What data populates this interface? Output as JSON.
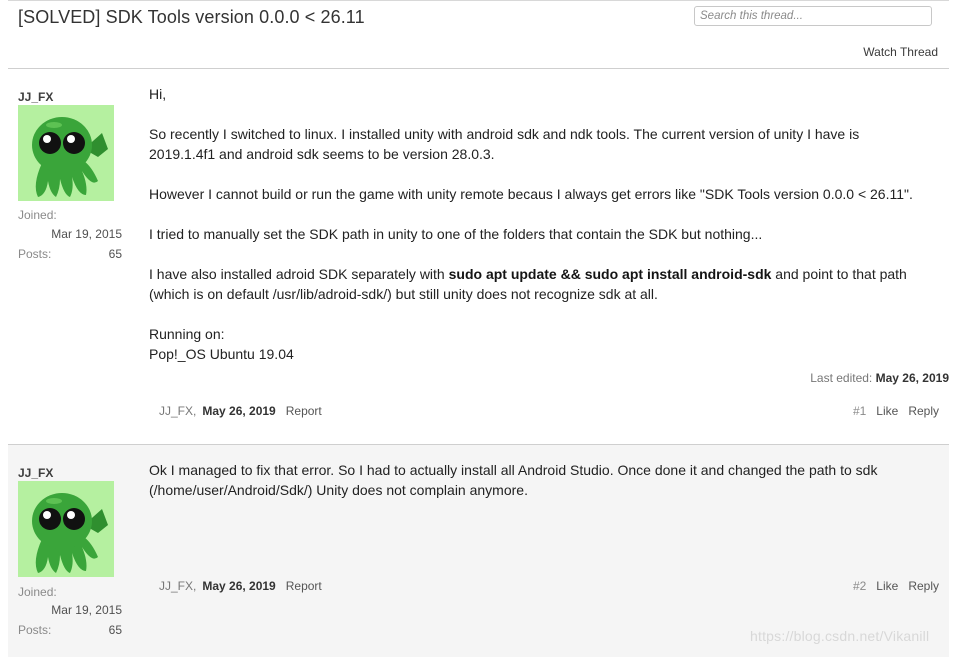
{
  "thread": {
    "title": "[SOLVED] SDK Tools version 0.0.0 < 26.11",
    "search_placeholder": "Search this thread...",
    "watch_label": "Watch Thread"
  },
  "posts": [
    {
      "author": "JJ_FX",
      "joined_label": "Joined:",
      "joined_value": "Mar 19, 2015",
      "posts_label": "Posts:",
      "posts_value": "65",
      "paragraphs": {
        "p1": "Hi,",
        "p2a": "So recently I switched to linux. I installed unity with android sdk and ndk tools. The current version of unity I have is",
        "p2b": "2019.1.4f1 and android sdk seems to be version 28.0.3.",
        "p3": "However I cannot build or run the game with unity remote becaus I always get errors like \"SDK Tools version 0.0.0 < 26.11\".",
        "p4": "I tried to manually set the SDK path in unity to one of the folders that contain the SDK but nothing...",
        "p5_pre": "I have also installed adroid SDK separately with ",
        "p5_bold": "sudo apt update && sudo apt install android-sdk",
        "p5_post": " and point to that path",
        "p5_line2": "(which is on default /usr/lib/adroid-sdk/) but still unity does not recognize sdk at all.",
        "p6a": "Running on:",
        "p6b": "Pop!_OS Ubuntu 19.04"
      },
      "edited_label": "Last edited:",
      "edited_date": "May 26, 2019",
      "footer_author": "JJ_FX,",
      "footer_date": "May 26, 2019",
      "report": "Report",
      "number": "#1",
      "like": "Like",
      "reply": "Reply"
    },
    {
      "author": "JJ_FX",
      "joined_label": "Joined:",
      "joined_value": "Mar 19, 2015",
      "posts_label": "Posts:",
      "posts_value": "65",
      "paragraphs": {
        "l1": "Ok I managed to fix that error. So I had to actually install all Android Studio. Once done it and changed the path to sdk",
        "l2": "(/home/user/Android/Sdk/) Unity does not complain anymore."
      },
      "footer_author": "JJ_FX,",
      "footer_date": "May 26, 2019",
      "report": "Report",
      "number": "#2",
      "like": "Like",
      "reply": "Reply"
    }
  ],
  "watermark": "https://blog.csdn.net/Vikanill",
  "colors": {
    "avatar_bg": "#b5f0a0",
    "avatar_body": "#3aa53a",
    "separator": "#cfcfcf"
  },
  "icons": [
    "cthulhu-avatar-icon"
  ]
}
